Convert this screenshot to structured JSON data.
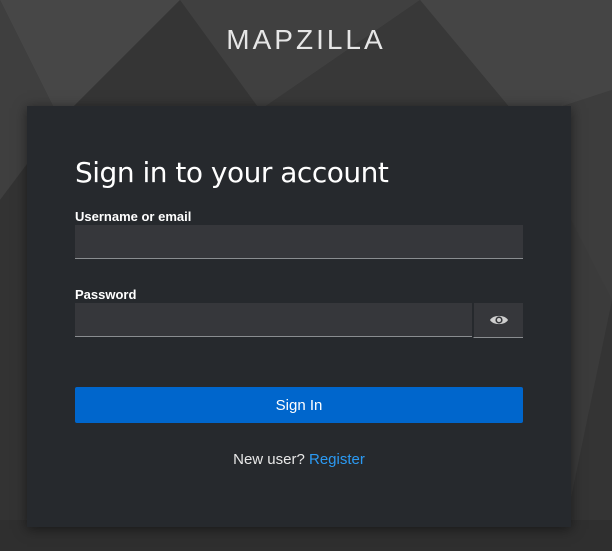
{
  "brand": "MAPZILLA",
  "login": {
    "title": "Sign in to your account",
    "username_label": "Username or email",
    "username_value": "",
    "password_label": "Password",
    "password_value": "",
    "show_password_icon": "eye-icon",
    "submit_label": "Sign In",
    "new_user_text": "New user?",
    "register_label": "Register"
  },
  "colors": {
    "background": "#3a3a3a",
    "card": "#26292d",
    "input": "#36373b",
    "primary": "#0066cc",
    "link": "#2b9af3"
  }
}
